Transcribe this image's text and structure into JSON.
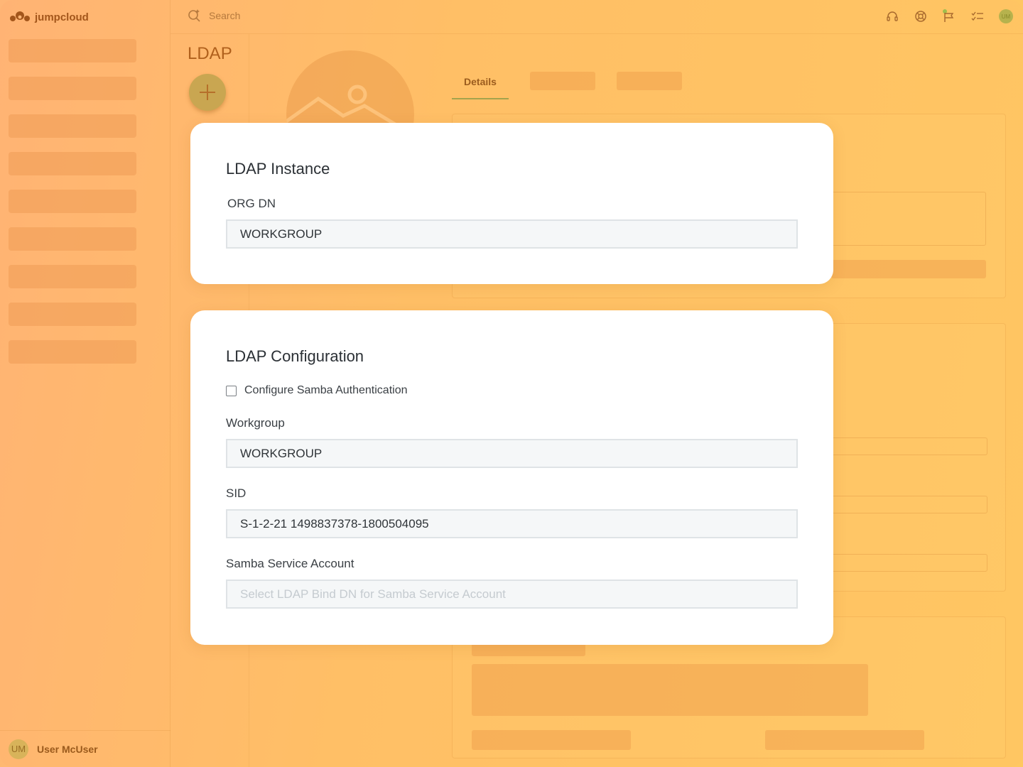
{
  "app": {
    "brand": "jumpcloud",
    "search_placeholder": "Search"
  },
  "sidebar": {
    "user_initials": "UM",
    "user_name": "User McUser"
  },
  "header": {
    "icons": [
      "headset-icon",
      "help-wheel-icon",
      "flag-icon",
      "checklist-icon"
    ],
    "avatar_initials": "UM"
  },
  "page": {
    "title": "LDAP",
    "tabs": [
      {
        "label": "Details",
        "active": true
      }
    ]
  },
  "ldap_instance": {
    "title": "LDAP Instance",
    "org_dn_label": "ORG DN",
    "org_dn_value": "WORKGROUP"
  },
  "ldap_configuration": {
    "title": "LDAP Configuration",
    "samba_checkbox_label": "Configure Samba Authentication",
    "samba_checked": false,
    "workgroup_label": "Workgroup",
    "workgroup_value": "WORKGROUP",
    "sid_label": "SID",
    "sid_value": "S-1-2-21 1498837378-1800504095",
    "samba_account_label": "Samba Service Account",
    "samba_account_placeholder": "Select LDAP Bind DN for Samba Service Account"
  },
  "colors": {
    "overlay_orange": "#ffbf66",
    "tab_underline": "#a4a34c",
    "card_bg": "#ffffff"
  }
}
